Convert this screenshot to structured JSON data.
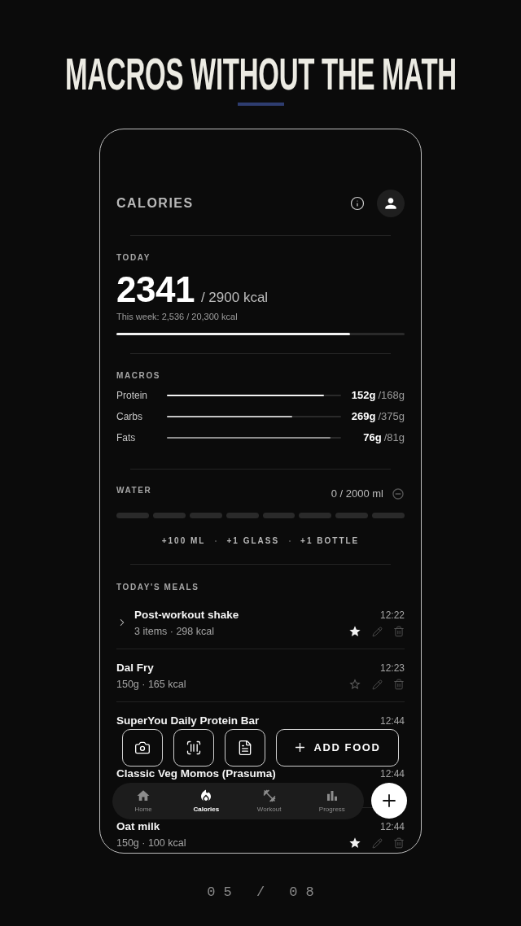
{
  "page": {
    "title": "MACROS WITHOUT THE MATH",
    "page_indicator": "05 / 08"
  },
  "header": {
    "title": "CALORIES"
  },
  "today": {
    "label": "TODAY",
    "value": "2341",
    "goal": "/ 2900 kcal",
    "week": "This week: 2,536 / 20,300 kcal",
    "level": 0.81
  },
  "macros": {
    "label": "MACROS",
    "items": [
      {
        "name": "Protein",
        "amount": "152g",
        "goal": "/168g",
        "level": 0.9,
        "color": "#f2f2f2"
      },
      {
        "name": "Carbs",
        "amount": "269g",
        "goal": "/375g",
        "level": 0.72,
        "color": "#c4c4c4"
      },
      {
        "name": "Fats",
        "amount": "76g",
        "goal": "/81g",
        "level": 0.94,
        "color": "#8e8e8e"
      }
    ]
  },
  "water": {
    "label": "WATER",
    "reading": "0 / 2000 ml",
    "segments": [
      {
        "filled": false
      },
      {
        "filled": false
      },
      {
        "filled": false
      },
      {
        "filled": false
      },
      {
        "filled": false
      },
      {
        "filled": false
      },
      {
        "filled": false
      },
      {
        "filled": false
      }
    ],
    "buttons": [
      "+100 ML",
      "+1 GLASS",
      "+1 BOTTLE"
    ]
  },
  "meals": {
    "label": "TODAY'S MEALS",
    "items": [
      {
        "kind": "group",
        "expanded": false,
        "name": "Post-workout shake",
        "detail": "3 items · 298 kcal",
        "time": "12:22",
        "favorite": true
      },
      {
        "kind": "item",
        "name": "Dal Fry",
        "detail": "150g · 165 kcal",
        "time": "12:23",
        "favorite": false
      },
      {
        "kind": "item",
        "name": "SuperYou Daily Protein Bar",
        "time": "12:44"
      },
      {
        "kind": "item",
        "name": "Classic Veg Momos (Prasuma)",
        "time": "12:44"
      },
      {
        "kind": "item",
        "name": "Oat milk",
        "detail": "150g · 100 kcal",
        "time": "12:44",
        "favorite": true
      }
    ]
  },
  "actions": {
    "add_label": "ADD FOOD"
  },
  "nav": {
    "items": [
      {
        "label": "Home",
        "selected": false
      },
      {
        "label": "Calories",
        "selected": true
      },
      {
        "label": "Workout",
        "selected": false
      },
      {
        "label": "Progress",
        "selected": false
      }
    ]
  }
}
